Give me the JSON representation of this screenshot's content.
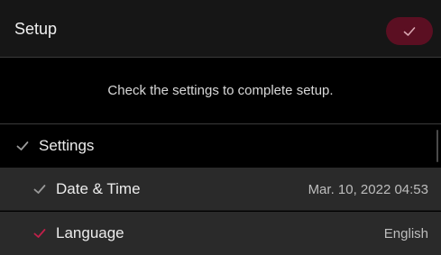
{
  "header": {
    "title": "Setup",
    "confirm_icon": "check-icon"
  },
  "message": {
    "text": "Check the settings to complete setup."
  },
  "settings": {
    "section_label": "Settings",
    "items": [
      {
        "label": "Date & Time",
        "value": "Mar. 10, 2022 04:53",
        "check_color": "#9a9a9a"
      },
      {
        "label": "Language",
        "value": "English",
        "check_color": "#c0204a"
      }
    ]
  },
  "colors": {
    "accent": "#5b0f22",
    "check_accent": "#c0204a",
    "check_neutral": "#9a9a9a"
  }
}
